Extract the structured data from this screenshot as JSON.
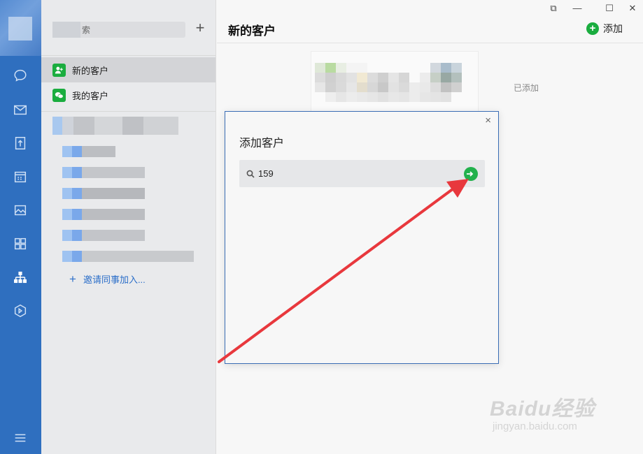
{
  "window": {
    "controls": [
      "⧉",
      "—",
      "☐",
      "✕"
    ]
  },
  "sidebar": {
    "search_placeholder": "索",
    "add_symbol": "+",
    "nav": [
      {
        "label": "新的客户",
        "icon": "add-contact-icon",
        "active": true
      },
      {
        "label": "我的客户",
        "icon": "wechat-icon",
        "active": false
      }
    ],
    "invite_symbol": "+",
    "invite_label": "邀请同事加入..."
  },
  "main": {
    "title": "新的客户",
    "add_label": "添加",
    "added_status": "已添加"
  },
  "dialog": {
    "title": "添加客户",
    "close": "×",
    "search_value": "159"
  },
  "watermark": {
    "brand": "Baidu经验",
    "url": "jingyan.baidu.com"
  },
  "colors": {
    "rail": "#2f6fbf",
    "accent_green": "#1aad3f",
    "link_blue": "#2c6fc9",
    "annotation_red": "#e8383d"
  }
}
